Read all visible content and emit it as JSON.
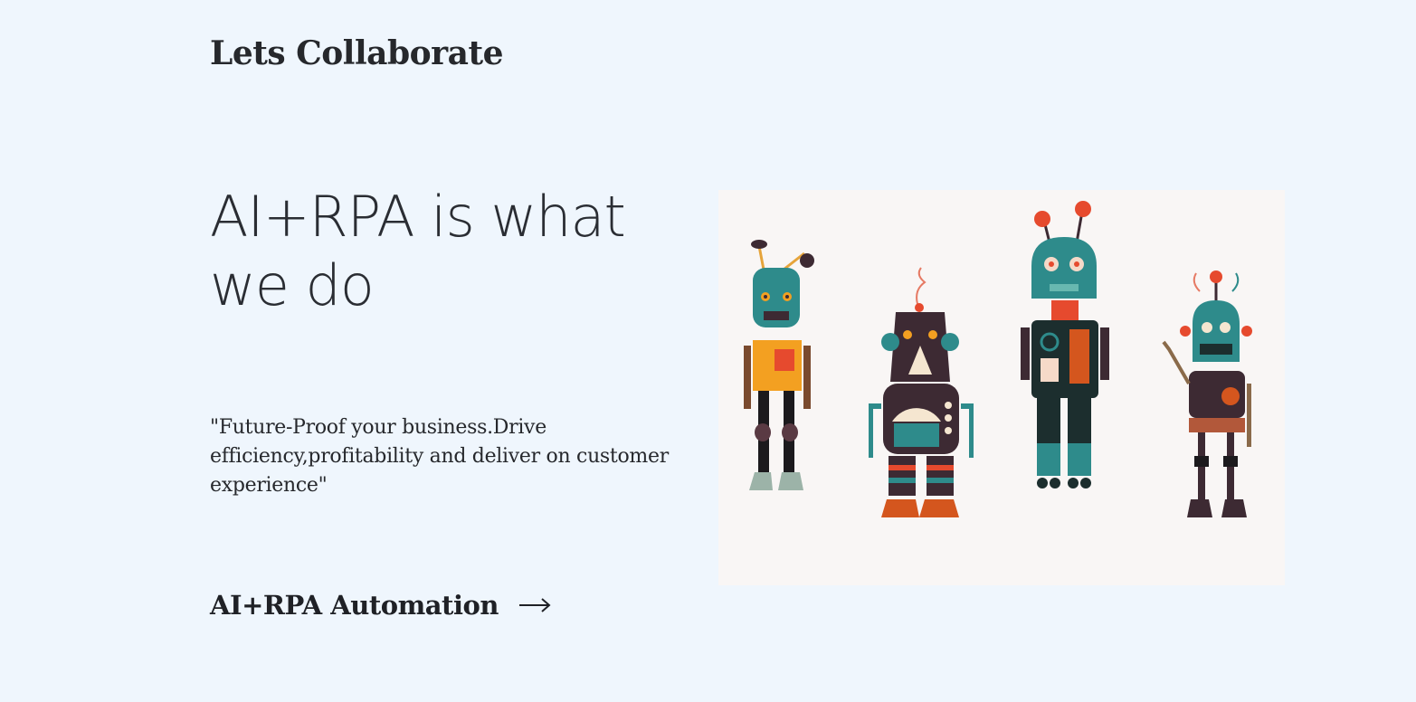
{
  "header": {
    "brand": "Lets Collaborate"
  },
  "hero": {
    "headline": "AI+RPA is what we do",
    "quote": "\"Future-Proof your business.Drive efficiency,profitability and deliver on customer experience\"",
    "cta_label": "AI+RPA Automation"
  },
  "icons": {
    "cta": "arrow-right-icon"
  },
  "colors": {
    "background": "#eff6fd",
    "text": "#26282c",
    "image_bg": "#f9f6f5",
    "robot_teal": "#2e8b8b",
    "robot_orange": "#f3a021",
    "robot_red": "#e64a2e",
    "robot_dark": "#3d2a33"
  }
}
